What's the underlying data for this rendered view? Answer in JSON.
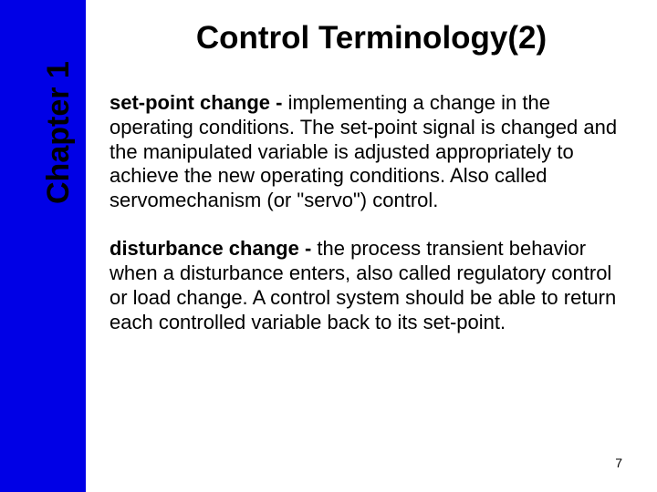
{
  "sidebar": {
    "chapter_label": "Chapter 1"
  },
  "title": "Control Terminology(2)",
  "paragraphs": {
    "p1_term": "set-point change - ",
    "p1_body": "implementing a change in the operating conditions.  The set-point signal is changed and the manipulated variable is adjusted appropriately to achieve the new operating conditions.  Also called servomechanism (or \"servo\") control.",
    "p2_term": "disturbance change - ",
    "p2_body": "the process transient behavior when a disturbance enters, also called regulatory control or load change.  A control system should be able to return each controlled variable back to its set-point."
  },
  "page_number": "7"
}
